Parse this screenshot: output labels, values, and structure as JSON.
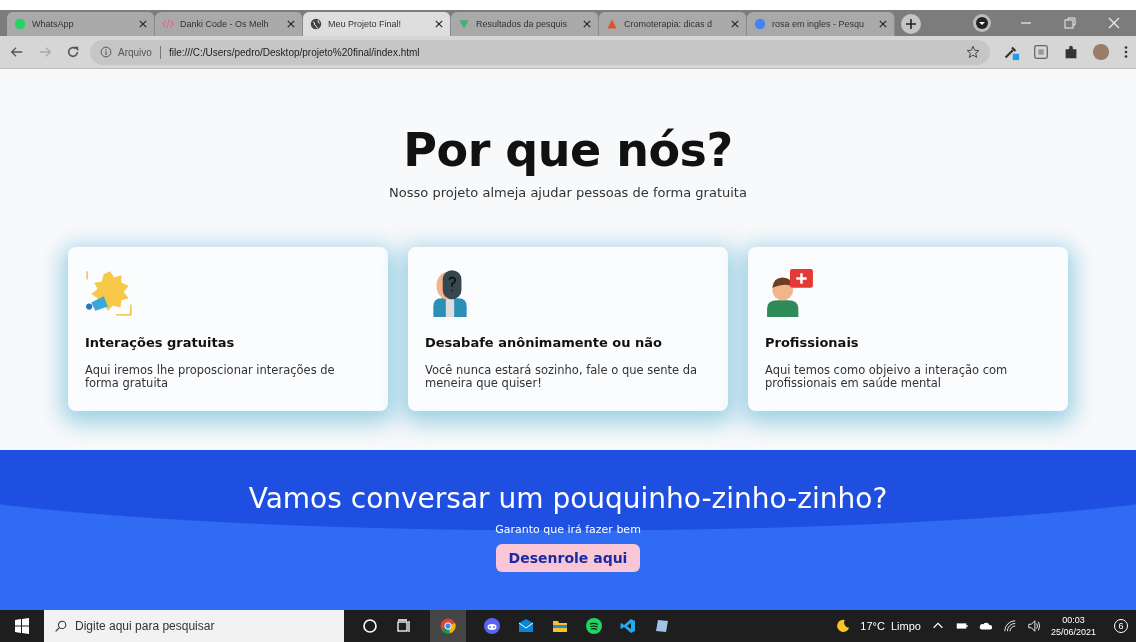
{
  "browser": {
    "tabs": [
      {
        "title": "WhatsApp",
        "selected": false
      },
      {
        "title": "Danki Code - Os Melh",
        "selected": false
      },
      {
        "title": "Meu Projeto Final!",
        "selected": true
      },
      {
        "title": "Resultados da pesquis",
        "selected": false
      },
      {
        "title": "Cromoterapia: dicas d",
        "selected": false
      },
      {
        "title": "rosa em ingles - Pesqu",
        "selected": false
      }
    ],
    "address_label": "Arquivo",
    "url": "file:///C:/Users/pedro/Desktop/projeto%20final/index.html"
  },
  "page": {
    "heading": "Por que nós?",
    "subheading": "Nosso projeto almeja ajudar pessoas de forma gratuita",
    "cards": [
      {
        "kind": "free",
        "title": "Interações gratuitas",
        "text": "Aqui iremos lhe proposcionar interações de forma gratuita"
      },
      {
        "kind": "anonymous",
        "title": "Desabafe anônimamente ou não",
        "text": "Você nunca estará sozinho, fale o que sente da meneira que quiser!"
      },
      {
        "kind": "professional",
        "title": "Profissionais",
        "text": "Aqui temos como objeivo a interação com profissionais em saúde mental"
      }
    ],
    "cta": {
      "title": "Vamos conversar um pouquinho-zinho-zinho?",
      "text": "Garanto que irá fazer bem",
      "button": "Desenrole aqui"
    }
  },
  "taskbar": {
    "search_placeholder": "Digite aqui para pesquisar",
    "weather": "17°C  Limpo",
    "time": "00:03",
    "date": "25/06/2021",
    "notifications": "6"
  }
}
